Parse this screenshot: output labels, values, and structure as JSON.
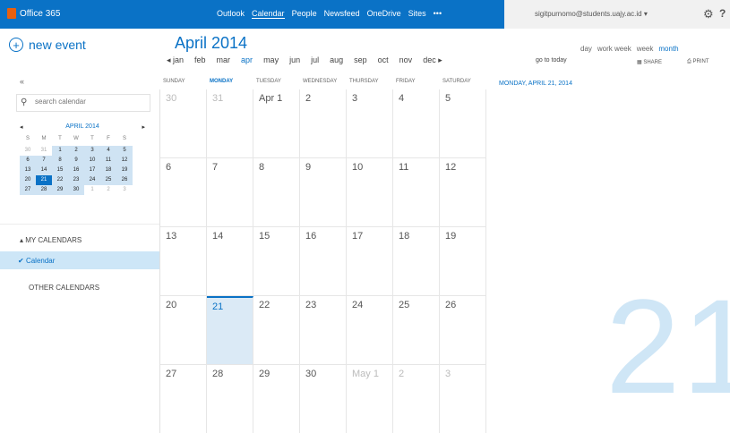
{
  "topbar": {
    "brand": "Office 365",
    "nav": [
      "Outlook",
      "Calendar",
      "People",
      "Newsfeed",
      "OneDrive",
      "Sites",
      "•••"
    ],
    "active_nav_index": 1,
    "account": "sigitpurnomo@students.uajy.ac.id",
    "account_caret": "▾",
    "help": "?",
    "gear": "⚙"
  },
  "sidebar": {
    "new_event": "new event",
    "collapse": "«",
    "search_placeholder": "search calendar",
    "minical": {
      "title": "APRIL 2014",
      "prev": "◂",
      "next": "▸",
      "day_names": [
        "S",
        "M",
        "T",
        "W",
        "T",
        "F",
        "S"
      ],
      "days": [
        [
          "30",
          "31",
          "1",
          "2",
          "3",
          "4",
          "5"
        ],
        [
          "6",
          "7",
          "8",
          "9",
          "10",
          "11",
          "12"
        ],
        [
          "13",
          "14",
          "15",
          "16",
          "17",
          "18",
          "19"
        ],
        [
          "20",
          "21",
          "22",
          "23",
          "24",
          "25",
          "26"
        ],
        [
          "27",
          "28",
          "29",
          "30",
          "1",
          "2",
          "3"
        ]
      ]
    },
    "my_calendars": "▴ MY CALENDARS",
    "calendar_item": "Calendar",
    "calendar_check": "✔",
    "other_calendars": "OTHER CALENDARS"
  },
  "main": {
    "month_title": "April 2014",
    "months": [
      "◂ jan",
      "feb",
      "mar",
      "apr",
      "may",
      "jun",
      "jul",
      "aug",
      "sep",
      "oct",
      "nov",
      "dec ▸"
    ],
    "current_month_index": 3,
    "go_to_today": "go to today",
    "views": [
      "day",
      "work week",
      "week",
      "month"
    ],
    "active_view_index": 3,
    "share": "SHARE",
    "print": "PRINT",
    "day_headers": [
      "SUNDAY",
      "MONDAY",
      "TUESDAY",
      "WEDNESDAY",
      "THURSDAY",
      "FRIDAY",
      "SATURDAY"
    ],
    "weeks": [
      [
        "30",
        "31",
        "Apr 1",
        "2",
        "3",
        "4",
        "5"
      ],
      [
        "6",
        "7",
        "8",
        "9",
        "10",
        "11",
        "12"
      ],
      [
        "13",
        "14",
        "15",
        "16",
        "17",
        "18",
        "19"
      ],
      [
        "20",
        "21",
        "22",
        "23",
        "24",
        "25",
        "26"
      ],
      [
        "27",
        "28",
        "29",
        "30",
        "May 1",
        "2",
        "3"
      ]
    ]
  },
  "right_panel": {
    "selected_date": "MONDAY, APRIL 21, 2014",
    "big_day": "21"
  }
}
